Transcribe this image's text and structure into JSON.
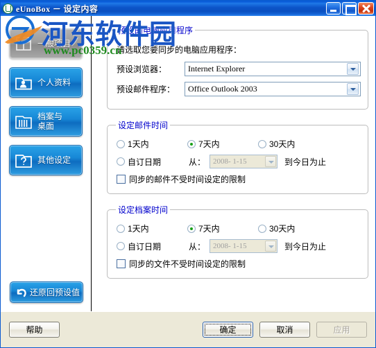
{
  "window": {
    "title": "eUnoBox － 设定内容",
    "app_icon": "eunobox-app-icon",
    "controls": {
      "minimize": "minimize-icon",
      "maximize": "maximize-icon",
      "close": "close-icon"
    }
  },
  "watermark": {
    "site_name": "河东软件园",
    "url": "www.pc0359.cn",
    "logo": "pc0359-logo"
  },
  "sidebar": {
    "items": [
      {
        "label": "一般项目",
        "icon": "box-icon",
        "active": true
      },
      {
        "label": "个人资料",
        "icon": "person-folder-icon",
        "active": false
      },
      {
        "label": "档案与\n桌面",
        "icon": "files-desktop-icon",
        "active": false
      },
      {
        "label": "其他设定",
        "icon": "question-folder-icon",
        "active": false
      }
    ],
    "restore": {
      "label": "还原回预设值",
      "icon": "undo-arrow-icon"
    }
  },
  "content": {
    "apps_group": {
      "legend": "预设的电脑应用程序",
      "hint": "请选取您要同步的电脑应用程序：",
      "browser": {
        "label": "预设浏览器：",
        "value": "Internet Explorer"
      },
      "mail": {
        "label": "预设邮件程序：",
        "value": "Office Outlook 2003"
      }
    },
    "mail_time_group": {
      "legend": "设定邮件时间",
      "options": [
        {
          "label": "1天内",
          "checked": false
        },
        {
          "label": "7天内",
          "checked": true
        },
        {
          "label": "30天内",
          "checked": false
        }
      ],
      "custom": {
        "label": "自订日期",
        "checked": false
      },
      "from_label": "从：",
      "date_value": "2008- 1-15",
      "until_label": "到今日为止",
      "checkbox": {
        "label": "同步的邮件不受时间设定的限制",
        "checked": false
      }
    },
    "file_time_group": {
      "legend": "设定档案时间",
      "options": [
        {
          "label": "1天内",
          "checked": false
        },
        {
          "label": "7天内",
          "checked": true
        },
        {
          "label": "30天内",
          "checked": false
        }
      ],
      "custom": {
        "label": "自订日期",
        "checked": false
      },
      "from_label": "从：",
      "date_value": "2008- 1-15",
      "until_label": "到今日为止",
      "checkbox": {
        "label": "同步的文件不受时间设定的限制",
        "checked": false
      }
    }
  },
  "footer": {
    "help": "帮助",
    "ok": "确定",
    "cancel": "取消",
    "apply": "应用"
  },
  "colors": {
    "title_blue": "#0a5ad8",
    "accent_blue": "#1787d6",
    "legend_blue": "#0000cc",
    "radio_green": "#18a018",
    "dialog_bg": "#ece9d8",
    "watermark_blue": "#1a56c4",
    "watermark_green": "#1f8a1f"
  }
}
